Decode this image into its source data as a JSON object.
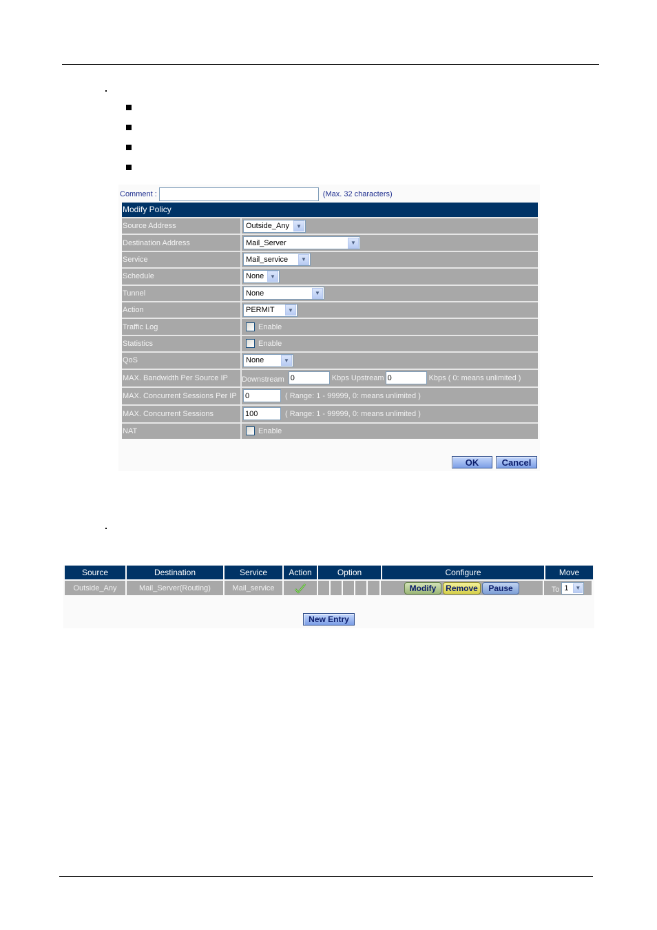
{
  "form": {
    "comment_label": "Comment :",
    "comment_value": "",
    "comment_hint": "(Max. 32 characters)",
    "title": "Modify Policy",
    "fields": {
      "source_address": {
        "label": "Source Address",
        "value": "Outside_Any"
      },
      "destination_address": {
        "label": "Destination Address",
        "value": "Mail_Server"
      },
      "service": {
        "label": "Service",
        "value": "Mail_service"
      },
      "schedule": {
        "label": "Schedule",
        "value": "None"
      },
      "tunnel": {
        "label": "Tunnel",
        "value": "None"
      },
      "action": {
        "label": "Action",
        "value": "PERMIT"
      },
      "traffic_log": {
        "label": "Traffic Log",
        "checkbox_label": "Enable",
        "checked": false
      },
      "statistics": {
        "label": "Statistics",
        "checkbox_label": "Enable",
        "checked": false
      },
      "qos": {
        "label": "QoS",
        "value": "None"
      },
      "max_bandwidth": {
        "label": "MAX. Bandwidth Per Source IP",
        "downstream_label": "Downstream",
        "downstream_value": "0",
        "upstream_label": "Kbps Upstream",
        "upstream_value": "0",
        "hint": "Kbps ( 0: means unlimited )"
      },
      "max_sessions_per_ip": {
        "label": "MAX. Concurrent Sessions Per IP",
        "value": "0",
        "hint": "( Range: 1 - 99999, 0: means unlimited )"
      },
      "max_sessions": {
        "label": "MAX. Concurrent Sessions",
        "value": "100",
        "hint": "( Range: 1 - 99999, 0: means unlimited )"
      },
      "nat": {
        "label": "NAT",
        "checkbox_label": "Enable",
        "checked": false
      }
    },
    "ok_label": "OK",
    "cancel_label": "Cancel"
  },
  "policy_list": {
    "headers": [
      "Source",
      "Destination",
      "Service",
      "Action",
      "Option",
      "Configure",
      "Move"
    ],
    "rows": [
      {
        "source": "Outside_Any",
        "destination": "Mail_Server(Routing)",
        "service": "Mail_service",
        "action_icon": "check-icon",
        "modify_label": "Modify",
        "remove_label": "Remove",
        "pause_label": "Pause",
        "move_to_label": "To",
        "move_to_value": "1"
      }
    ],
    "new_entry_label": "New Entry"
  },
  "icons": {
    "dropdown_arrow": "chevron-down-icon",
    "bullet": "square-bullet-icon",
    "check": "check-icon"
  },
  "colors": {
    "header_bg": "#003366",
    "row_bg": "#a8a8a8",
    "comment_text": "#1f2f8f",
    "action_check": "#3aa315"
  }
}
